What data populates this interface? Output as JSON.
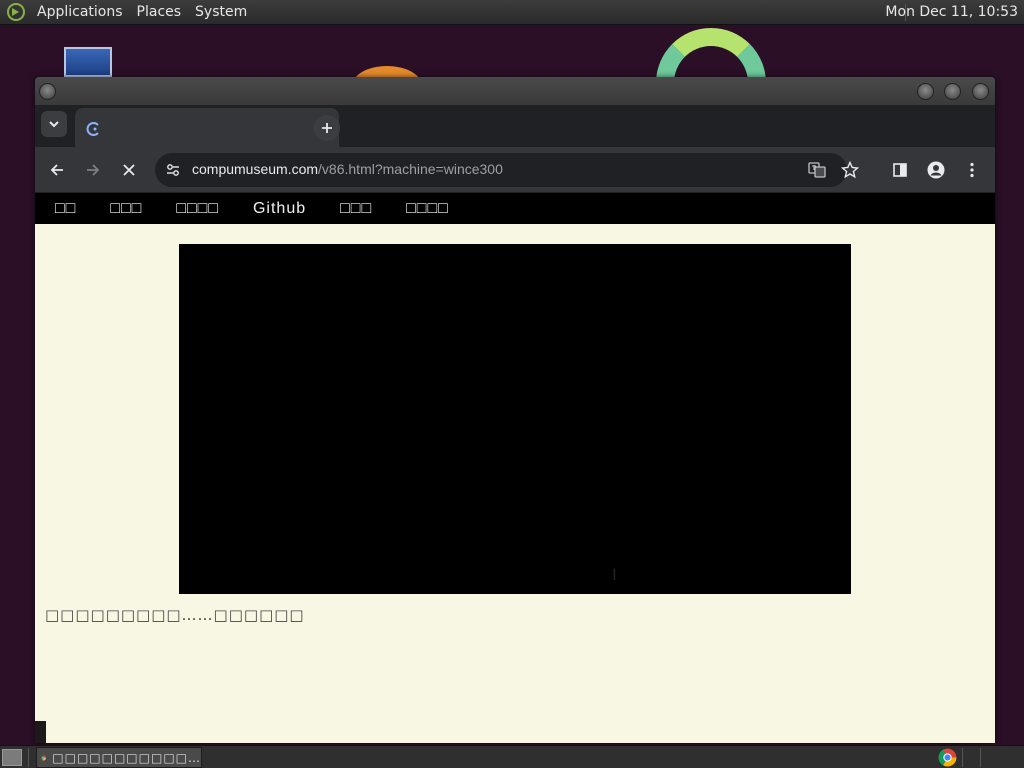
{
  "top_panel": {
    "menus": [
      "Applications",
      "Places",
      "System"
    ],
    "clock": "Mon Dec 11, 10:53"
  },
  "browser": {
    "tab": {
      "title": ""
    },
    "address": {
      "host": "compumuseum.com",
      "path": "/v86.html?machine=wince300"
    }
  },
  "page": {
    "nav": [
      "□□",
      "□□□",
      "□□□□",
      "Github",
      "□□□",
      "□□□□"
    ],
    "status": "□□□□□□□□□……□□□□□□"
  },
  "taskbar": {
    "task_label": "□□□□□□□□□□□…"
  },
  "colors": {
    "page_bg": "#f7f7e4",
    "nav_bg": "#000000",
    "omnibox_bg": "#202124",
    "toolbar_bg": "#35363a"
  },
  "icons": [
    "distro-logo-icon",
    "chevron-down-icon",
    "favicon-icon",
    "close-icon",
    "plus-icon",
    "back-arrow-icon",
    "forward-arrow-icon",
    "stop-icon",
    "site-settings-icon",
    "translate-icon",
    "star-icon",
    "side-panel-icon",
    "profile-icon",
    "more-vert-icon",
    "chrome-icon",
    "show-desktop-icon"
  ]
}
